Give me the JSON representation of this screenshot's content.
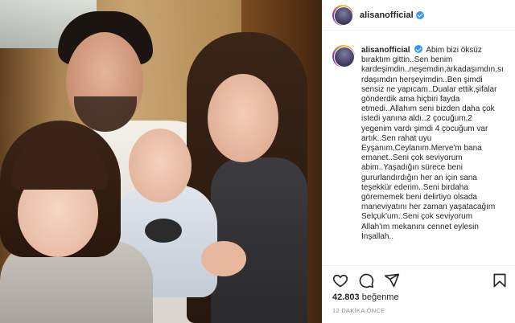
{
  "post": {
    "username": "alisanofficial",
    "verified": true,
    "caption": "Abim bizi öksüz\nbıraktım gittin..Sen benim\nkardeşimdin..neşemdin,arkadaşımdın,sı\nrdaşımdın herşeyimdin..Ben şimdi\nsensiz ne yapıcam..Dualar ettik,şifalar\ngönderdik ama hiçbiri fayda\netmedi..Allahım seni bizden daha çok\nistedi yanına aldı..2 çocuğum,2\nyegenim vardı şimdi 4 çocuğum var\nartık..Sen rahat uyu\nEyşanım,Ceylanım.Merve'm bana\nemanet..Seni çok seviyorum\nabim..Yaşadığın sürece beni\ngururlandırdığın her an için sana\nteşekkür ederim..Seni birdaha\ngörememek beni delirtiyo olsada\nmaneviyatını her zaman yaşatacağım\nSelçuk'um..Seni çok seviyorum\nAllah'ım mekanını cennet eylesin\nİnşallah..",
    "likes_count": "42.803",
    "likes_label": "beğenme",
    "timestamp": "12 DAKİKA ÖNCE"
  },
  "icons": {
    "like": "heart-icon",
    "comment": "comment-icon",
    "share": "share-icon",
    "save": "bookmark-icon",
    "verified": "verified-badge-icon"
  },
  "colors": {
    "verified": "#3897f0",
    "text": "#262626",
    "muted": "#8e8e8e",
    "border": "#efefef"
  }
}
